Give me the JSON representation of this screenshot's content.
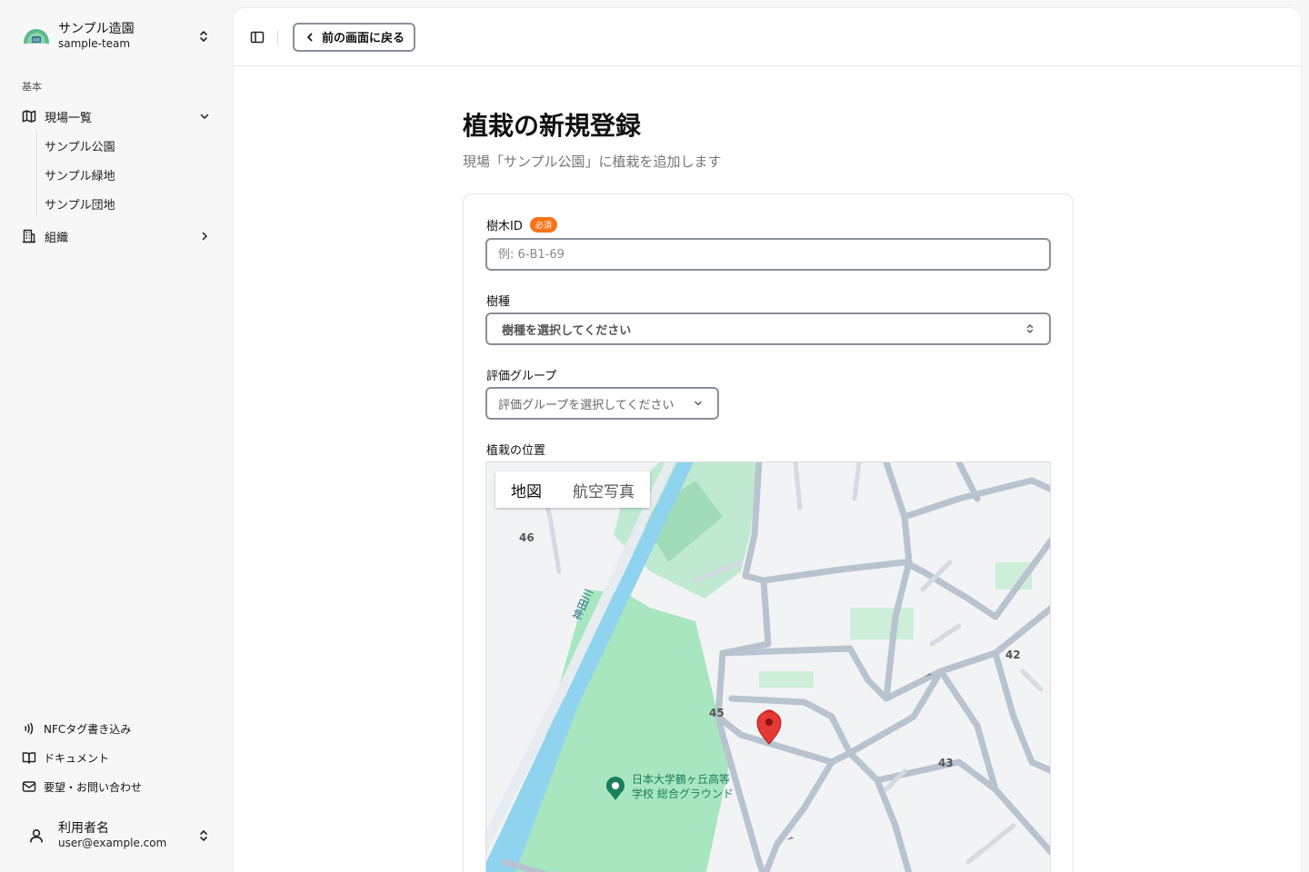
{
  "sidebar": {
    "team": {
      "name": "サンプル造園",
      "slug": "sample-team"
    },
    "section_label": "基本",
    "nav": {
      "sites": {
        "label": "現場一覧"
      },
      "org": {
        "label": "組織"
      }
    },
    "sites": [
      "サンプル公園",
      "サンプル緑地",
      "サンプル団地"
    ],
    "footer": {
      "nfc": "NFCタグ書き込み",
      "docs": "ドキュメント",
      "contact": "要望・お問い合わせ"
    },
    "user": {
      "name": "利用者名",
      "email": "user@example.com"
    }
  },
  "topbar": {
    "back_label": "前の画面に戻る"
  },
  "page": {
    "title": "植栽の新規登録",
    "subtitle": "現場「サンプル公園」に植栽を追加します"
  },
  "form": {
    "tree_id": {
      "label": "樹木ID",
      "badge": "必須",
      "placeholder": "例: 6-B1-69"
    },
    "species": {
      "label": "樹種",
      "placeholder": "樹種を選択してください"
    },
    "group": {
      "label": "評価グループ",
      "placeholder": "評価グループを選択してください"
    },
    "location": {
      "label": "植栽の位置"
    }
  },
  "map": {
    "tabs": {
      "map": "地図",
      "satellite": "航空写真"
    },
    "labels": {
      "l46": "46",
      "l42": "42",
      "l45": "45",
      "l43": "43"
    },
    "river": "神田川",
    "poi": {
      "line1": "日本大学鶴ヶ丘高等",
      "line2": "学校 総合グラウンド"
    },
    "colors": {
      "park": "#a8e6c0",
      "river": "#8fd3ef",
      "road": "#b8c3cf",
      "marker": "#e53935"
    }
  }
}
